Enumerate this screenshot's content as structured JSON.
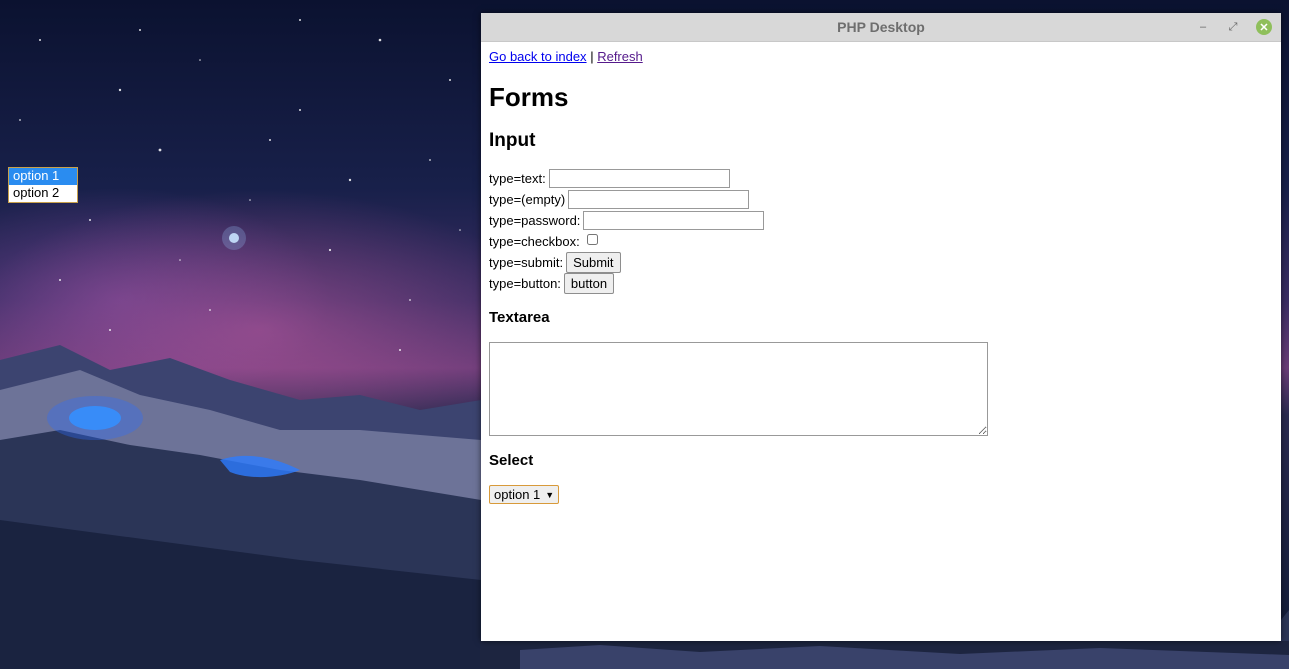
{
  "window": {
    "title": "PHP Desktop",
    "minimize_glyph": "–",
    "maximize_glyph": "⤢",
    "close_glyph": "✕"
  },
  "nav": {
    "back_link": "Go back to index",
    "separator": "|",
    "refresh_link": "Refresh"
  },
  "page": {
    "title": "Forms",
    "input_section": "Input",
    "textarea_section": "Textarea",
    "select_section": "Select"
  },
  "inputs": {
    "text_label": "type=text:",
    "text_value": "",
    "empty_label": "type=(empty)",
    "empty_value": "",
    "password_label": "type=password:",
    "password_value": "",
    "checkbox_label": "type=checkbox:",
    "checkbox_checked": false,
    "submit_label": "type=submit:",
    "submit_button": "Submit",
    "button_label": "type=button:",
    "button_button": "button"
  },
  "textarea": {
    "value": ""
  },
  "select": {
    "selected": "option 1",
    "arrow": "▼",
    "options": [
      "option 1",
      "option 2"
    ]
  },
  "colors": {
    "link": "#0000ee",
    "visited_link": "#551a8b",
    "selected_option_bg": "#2a8cf0",
    "close_button": "#8fbf5b",
    "select_border": "#d89a3a"
  }
}
